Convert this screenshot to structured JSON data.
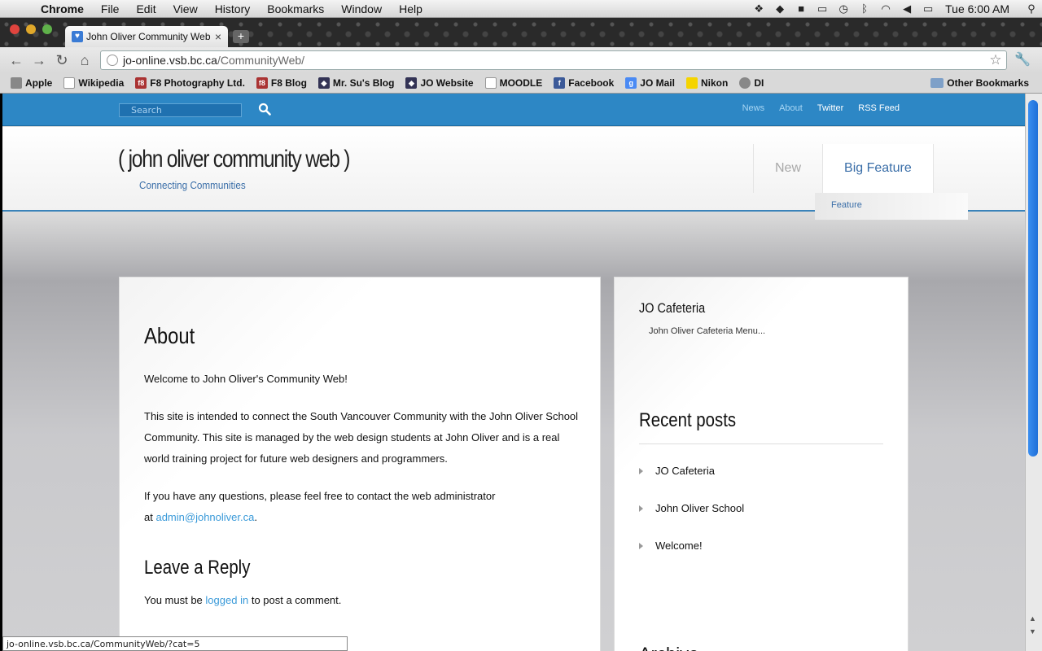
{
  "menubar": {
    "app": "Chrome",
    "items": [
      "File",
      "Edit",
      "View",
      "History",
      "Bookmarks",
      "Window",
      "Help"
    ],
    "clock": "Tue 6:00 AM"
  },
  "browser": {
    "tab_title": "John Oliver Community Web",
    "url_host": "jo-online.vsb.bc.ca",
    "url_path": "/CommunityWeb/",
    "bookmarks": [
      "Apple",
      "Wikipedia",
      "F8 Photography Ltd.",
      "F8 Blog",
      "Mr. Su's Blog",
      "JO Website",
      "MOODLE",
      "Facebook",
      "JO Mail",
      "Nikon",
      "DI"
    ],
    "other_bookmarks": "Other Bookmarks",
    "status_url": "jo-online.vsb.bc.ca/CommunityWeb/?cat=5"
  },
  "site": {
    "search_placeholder": "Search",
    "top_links": [
      "News",
      "About",
      "Twitter",
      "RSS Feed"
    ],
    "title": "( john oliver community web )",
    "tagline": "Connecting Communities",
    "nav": [
      "New",
      "Big Feature"
    ],
    "dropdown_item": "Feature"
  },
  "post": {
    "title": "About",
    "p1": "Welcome to John Oliver's Community Web!",
    "p2": "This site is intended to connect the South Vancouver Community with the John Oliver School Community. This site is managed by the web design students at John Oliver and is a real world training project for future web designers and programmers.",
    "p3_a": "If you have any questions, please feel free to contact the web administrator",
    "p3_at": "at",
    "email": "admin@johnoliver.ca",
    "reply_title": "Leave a Reply",
    "reply_a": "You must be",
    "reply_link": "logged in",
    "reply_b": "to post a comment."
  },
  "sidebar": {
    "cafe_title": "JO Cafeteria",
    "cafe_link": "John Oliver Cafeteria Menu...",
    "recent_title": "Recent posts",
    "recent": [
      "JO Cafeteria",
      "John Oliver School",
      "Welcome!"
    ],
    "archive_title": "Archive"
  }
}
